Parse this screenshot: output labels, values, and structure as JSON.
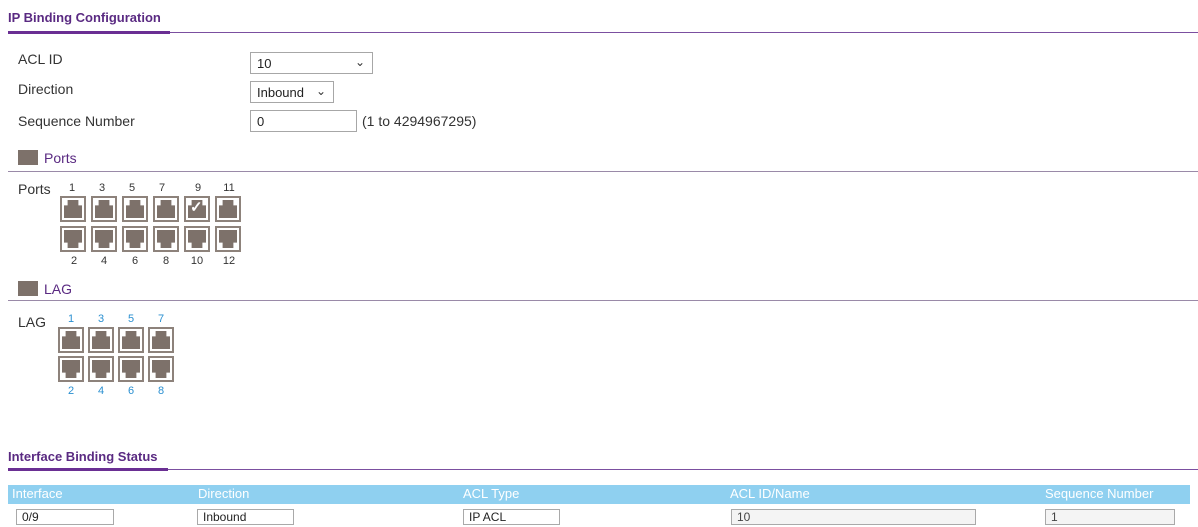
{
  "config": {
    "title": "IP Binding Configuration",
    "acl_id": {
      "label": "ACL ID",
      "value": "10"
    },
    "direction": {
      "label": "Direction",
      "value": "Inbound"
    },
    "sequence": {
      "label": "Sequence Number",
      "value": "0",
      "hint": "(1 to 4294967295)"
    }
  },
  "ports": {
    "title": "Ports",
    "row_label": "Ports",
    "top_numbers": [
      "1",
      "3",
      "5",
      "7",
      "9",
      "11"
    ],
    "bottom_numbers": [
      "2",
      "4",
      "6",
      "8",
      "10",
      "12"
    ],
    "selected": [
      "9"
    ]
  },
  "lag": {
    "title": "LAG",
    "row_label": "LAG",
    "top_numbers": [
      "1",
      "3",
      "5",
      "7"
    ],
    "bottom_numbers": [
      "2",
      "4",
      "6",
      "8"
    ]
  },
  "status": {
    "title": "Interface Binding Status",
    "columns": [
      "Interface",
      "Direction",
      "ACL Type",
      "ACL ID/Name",
      "Sequence Number"
    ],
    "rows": [
      [
        "0/9",
        "Inbound",
        "IP ACL",
        "10",
        "1"
      ]
    ]
  },
  "colors": {
    "accent": "#5a2a82",
    "header_bg": "#8fd0f0",
    "port": "#7d716a",
    "lag_numbers": "#2a8fd0"
  },
  "icons": {
    "dropdown": "chevron-down-icon",
    "port": "ethernet-port-icon",
    "selected": "check-icon",
    "section": "port-section-icon"
  }
}
